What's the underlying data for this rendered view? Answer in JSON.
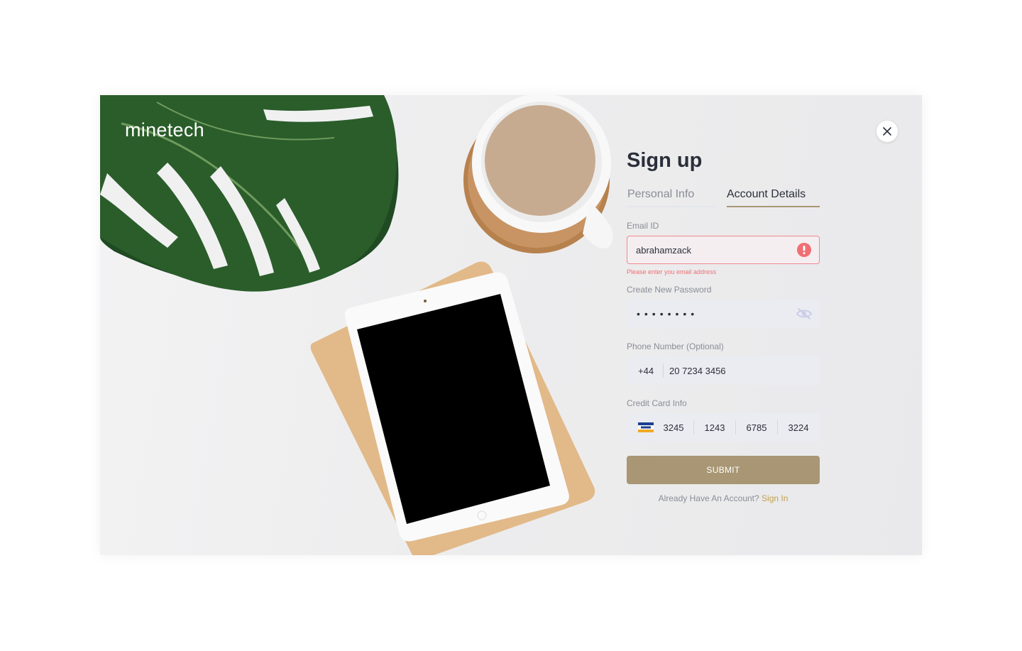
{
  "brand": {
    "name": "minetech"
  },
  "form": {
    "title": "Sign up",
    "tabs": [
      {
        "label": "Personal Info",
        "active": false
      },
      {
        "label": "Account Details",
        "active": true
      }
    ],
    "email": {
      "label": "Email ID",
      "value": "abrahamzack",
      "error": "Please enter you email address",
      "icon": "error-icon"
    },
    "password": {
      "label": "Create New Password",
      "masked_value": "••••••••",
      "icon": "eye-off-icon"
    },
    "phone": {
      "label": "Phone Number (Optional)",
      "country_code": "+44",
      "number": "20 7234 3456"
    },
    "credit_card": {
      "label": "Credit Card Info",
      "brand_icon": "visa-icon",
      "segments": [
        "3245",
        "1243",
        "6785",
        "3224"
      ]
    },
    "submit_label": "SUBMIT",
    "signin_prompt": "Already Have An Account?",
    "signin_link": "Sign In"
  },
  "colors": {
    "accent": "#a89674",
    "error": "#ef6f72",
    "link": "#c2a051",
    "title": "#2b2f3a"
  }
}
